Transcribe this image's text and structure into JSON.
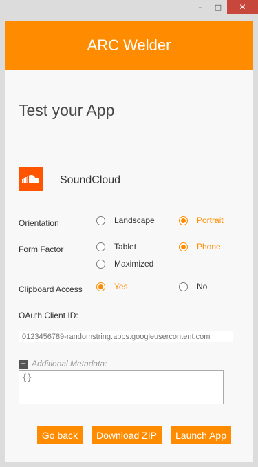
{
  "window": {
    "controls": {
      "minimize": "–",
      "maximize": "□",
      "close": "✕"
    }
  },
  "header": {
    "title": "ARC Welder",
    "color": "#ff8c00"
  },
  "page_title": "Test your App",
  "app": {
    "name": "SoundCloud",
    "icon": "soundcloud-icon",
    "icon_color": "#ff5500"
  },
  "orientation": {
    "label": "Orientation",
    "options": [
      "Landscape",
      "Portrait"
    ],
    "selected": "Portrait"
  },
  "form_factor": {
    "label": "Form Factor",
    "options": [
      "Tablet",
      "Phone",
      "Maximized"
    ],
    "selected": "Phone"
  },
  "clipboard": {
    "label": "Clipboard Access",
    "options": [
      "Yes",
      "No"
    ],
    "selected": "Yes"
  },
  "oauth": {
    "label": "OAuth Client ID:",
    "placeholder": "0123456789-randomstring.apps.googleusercontent.com"
  },
  "metadata": {
    "toggle_icon": "+",
    "label": "Additional Metadata:",
    "value": "{}"
  },
  "buttons": {
    "go_back": "Go back",
    "download_zip": "Download ZIP",
    "launch_app": "Launch App"
  }
}
